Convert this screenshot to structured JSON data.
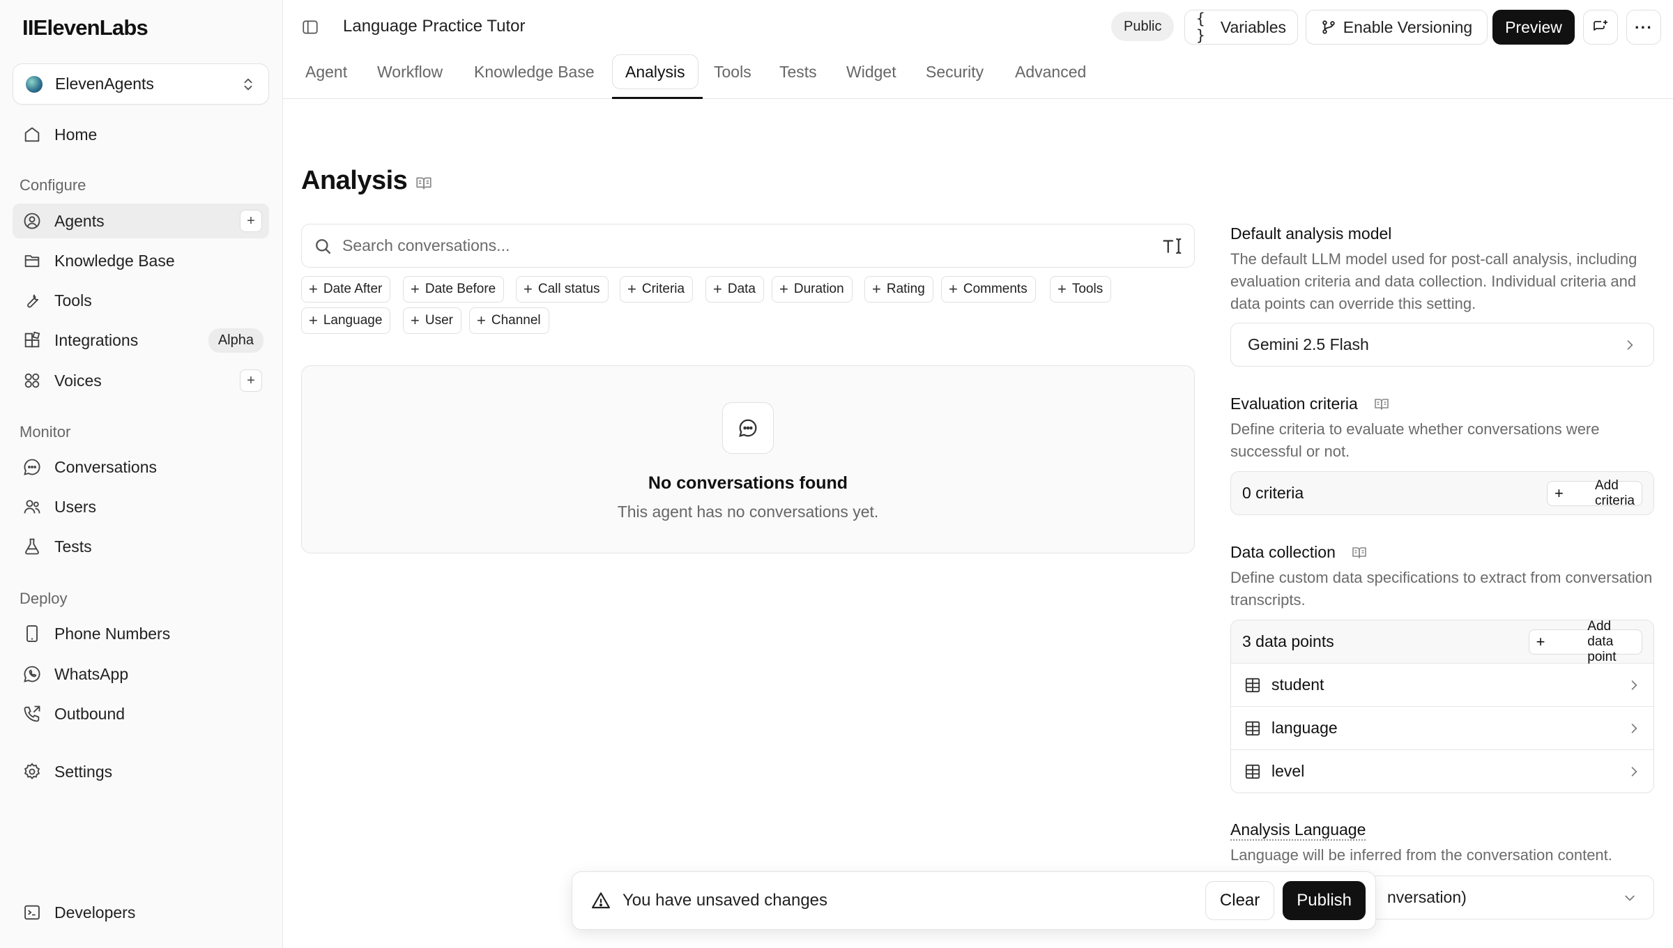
{
  "sidebar": {
    "logo": "IIElevenLabs",
    "workspace": "ElevenAgents",
    "home": "Home",
    "sections": {
      "configure": "Configure",
      "monitor": "Monitor",
      "deploy": "Deploy"
    },
    "items": {
      "agents": "Agents",
      "knowledge_base": "Knowledge Base",
      "tools": "Tools",
      "integrations": "Integrations",
      "integrations_badge": "Alpha",
      "voices": "Voices",
      "conversations": "Conversations",
      "users": "Users",
      "tests": "Tests",
      "phone_numbers": "Phone Numbers",
      "whatsapp": "WhatsApp",
      "outbound": "Outbound",
      "settings": "Settings",
      "developers": "Developers"
    },
    "plus": "+"
  },
  "topbar": {
    "title": "Language Practice Tutor",
    "public_badge": "Public",
    "variables": "Variables",
    "variables_glyph": "{ }",
    "enable_versioning": "Enable Versioning",
    "preview": "Preview",
    "more_glyph": "···"
  },
  "tabs": [
    "Agent",
    "Workflow",
    "Knowledge Base",
    "Analysis",
    "Tools",
    "Tests",
    "Widget",
    "Security",
    "Advanced"
  ],
  "active_tab": "Analysis",
  "main": {
    "title": "Analysis",
    "search_placeholder": "Search conversations...",
    "filters": [
      "Date After",
      "Date Before",
      "Call status",
      "Criteria",
      "Data",
      "Duration",
      "Rating",
      "Comments",
      "Tools",
      "Language",
      "User",
      "Channel"
    ],
    "plus": "+",
    "empty_title": "No conversations found",
    "empty_sub": "This agent has no conversations yet."
  },
  "right_panel": {
    "default_model_title": "Default analysis model",
    "default_model_desc": "The default LLM model used for post-call analysis, including evaluation criteria and data collection. Individual criteria and data points can override this setting.",
    "model_value": "Gemini 2.5 Flash",
    "eval_title": "Evaluation criteria",
    "eval_desc": "Define criteria to evaluate whether conversations were successful or not.",
    "criteria_count": "0 criteria",
    "add_criteria": "Add criteria",
    "data_title": "Data collection",
    "data_desc": "Define custom data specifications to extract from conversation transcripts.",
    "data_count": "3 data points",
    "add_data_point": "Add data point",
    "data_points": [
      "student",
      "language",
      "level"
    ],
    "analysis_lang_title": "Analysis Language",
    "analysis_lang_desc": "Language will be inferred from the conversation content.",
    "lang_value": "nversation)"
  },
  "toast": {
    "message": "You have unsaved changes",
    "clear": "Clear",
    "publish": "Publish"
  },
  "colors": {
    "accent": "#111111",
    "muted_text": "#6b6b6b",
    "sidebar_bg": "#fafafa"
  }
}
